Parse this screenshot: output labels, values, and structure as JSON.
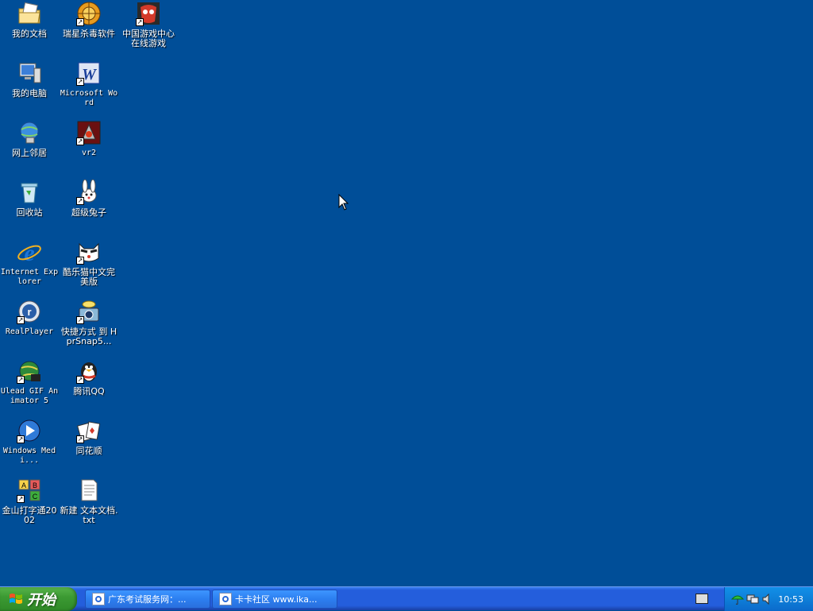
{
  "desktop_icons": [
    {
      "label": "我的文档",
      "mono": false,
      "shortcut": false,
      "icon": "folder-documents-icon"
    },
    {
      "label": "瑞星杀毒软件",
      "mono": false,
      "shortcut": true,
      "icon": "rising-antivirus-icon"
    },
    {
      "label": "中国游戏中心在线游戏",
      "mono": false,
      "shortcut": true,
      "icon": "chinagame-mask-icon"
    },
    {
      "label": "我的电脑",
      "mono": false,
      "shortcut": false,
      "icon": "computer-icon"
    },
    {
      "label": "Microsoft Word",
      "mono": true,
      "shortcut": true,
      "icon": "word-icon"
    },
    {
      "label": "网上邻居",
      "mono": false,
      "shortcut": false,
      "icon": "network-icon"
    },
    {
      "label": "vr2",
      "mono": true,
      "shortcut": true,
      "icon": "vr2-game-icon"
    },
    {
      "label": "回收站",
      "mono": false,
      "shortcut": false,
      "icon": "recycle-bin-icon"
    },
    {
      "label": "超级兔子",
      "mono": false,
      "shortcut": true,
      "icon": "rabbit-icon"
    },
    {
      "label": "Internet Explorer",
      "mono": true,
      "shortcut": false,
      "icon": "internet-explorer-icon"
    },
    {
      "label": "酷乐猫中文完美版",
      "mono": false,
      "shortcut": true,
      "icon": "cat-icon"
    },
    {
      "label": "RealPlayer",
      "mono": true,
      "shortcut": true,
      "icon": "realplayer-icon"
    },
    {
      "label": "快捷方式 到 HprSnap5...",
      "mono": false,
      "shortcut": true,
      "icon": "camera-icon"
    },
    {
      "label": "Ulead GIF Animator 5",
      "mono": true,
      "shortcut": true,
      "icon": "ulead-globe-icon"
    },
    {
      "label": "腾讯QQ",
      "mono": false,
      "shortcut": true,
      "icon": "qq-penguin-icon"
    },
    {
      "label": "Windows Medi...",
      "mono": true,
      "shortcut": true,
      "icon": "media-player-icon"
    },
    {
      "label": "同花顺",
      "mono": false,
      "shortcut": true,
      "icon": "cards-icon"
    },
    {
      "label": "金山打字通2002",
      "mono": false,
      "shortcut": true,
      "icon": "abc-blocks-icon"
    },
    {
      "label": "新建 文本文档.txt",
      "mono": false,
      "shortcut": false,
      "icon": "text-file-icon"
    }
  ],
  "taskbar": {
    "start_label": "开始",
    "tasks": [
      {
        "label": "广东考试服务网：..."
      },
      {
        "label": "卡卡社区 www.ika..."
      }
    ],
    "clock": "10:53"
  },
  "colors": {
    "desktop_bg": "#004E98",
    "taskbar": "#245EDC",
    "start_green": "#3C9A33",
    "tray": "#0E7FD8"
  }
}
